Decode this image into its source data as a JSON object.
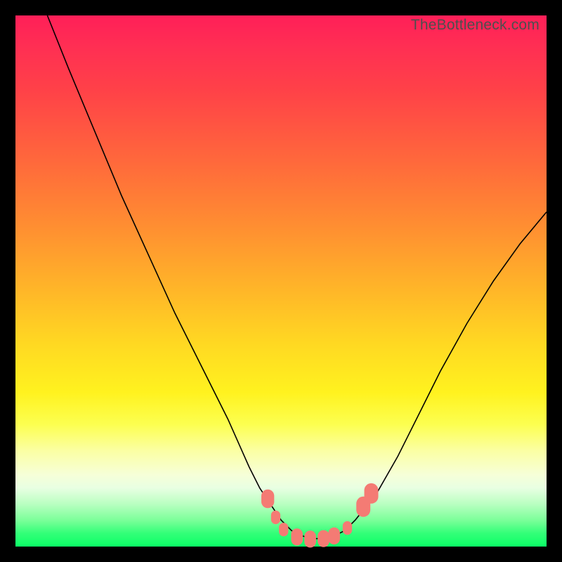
{
  "watermark": "TheBottleneck.com",
  "colors": {
    "frame": "#000000",
    "curve": "#000000",
    "marker": "#f47b74",
    "gradient_top": "#ff1f58",
    "gradient_bottom": "#0bff66"
  },
  "chart_data": {
    "type": "line",
    "title": "",
    "xlabel": "",
    "ylabel": "",
    "xlim": [
      0,
      100
    ],
    "ylim": [
      0,
      100
    ],
    "series": [
      {
        "name": "bottleneck-curve",
        "x": [
          6,
          10,
          15,
          20,
          25,
          30,
          35,
          40,
          44,
          46,
          48,
          50,
          52,
          54,
          56,
          58,
          60,
          62,
          64,
          68,
          72,
          76,
          80,
          85,
          90,
          95,
          100
        ],
        "y": [
          100,
          90,
          78,
          66,
          55,
          44,
          34,
          24,
          15,
          11,
          8,
          5,
          3,
          2,
          1.5,
          1.5,
          2,
          3,
          5,
          10,
          17,
          25,
          33,
          42,
          50,
          57,
          63
        ]
      }
    ],
    "markers": [
      {
        "x": 47.5,
        "y": 9.0,
        "size": 2.2
      },
      {
        "x": 49.0,
        "y": 5.5,
        "size": 1.6
      },
      {
        "x": 50.5,
        "y": 3.2,
        "size": 1.6
      },
      {
        "x": 53.0,
        "y": 1.8,
        "size": 2.0
      },
      {
        "x": 55.5,
        "y": 1.4,
        "size": 2.0
      },
      {
        "x": 58.0,
        "y": 1.5,
        "size": 2.0
      },
      {
        "x": 60.0,
        "y": 2.0,
        "size": 2.0
      },
      {
        "x": 62.5,
        "y": 3.5,
        "size": 1.6
      },
      {
        "x": 65.5,
        "y": 7.5,
        "size": 2.4
      },
      {
        "x": 67.0,
        "y": 10.0,
        "size": 2.4
      }
    ],
    "annotations": []
  }
}
